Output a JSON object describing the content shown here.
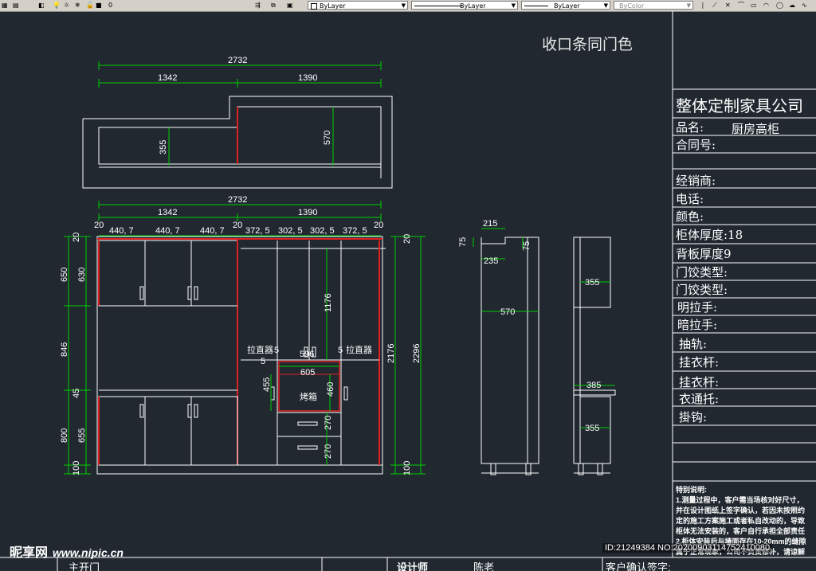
{
  "toolbar": {
    "layer_number": "0",
    "color_control": "ByLayer",
    "linetype_control": "ByLayer",
    "lineweight_control": "ByLayer",
    "plotstyle_control": "ByColor"
  },
  "drawing": {
    "note_title": "收口条同门色",
    "top_view": {
      "overall_width": "2732",
      "left_width": "1342",
      "right_width": "1390",
      "left_depth": "355",
      "right_depth": "570"
    },
    "front_view": {
      "overall_width": "2732",
      "left_width": "1342",
      "right_width": "1390",
      "columns_left": [
        "20",
        "440, 7",
        "440, 7",
        "440, 7",
        "20"
      ],
      "columns_right": [
        "372, 5",
        "302, 5",
        "302, 5",
        "372, 5",
        "20"
      ],
      "left_heights": [
        "650",
        "846",
        "800",
        "100"
      ],
      "left_inner_heights": [
        "20",
        "630",
        "45",
        "655"
      ],
      "right_heights": [
        "20",
        "2176",
        "2296",
        "100"
      ],
      "center_height": "1176",
      "pull_basket_label": "拉直器",
      "pull_basket_value": "5",
      "oven_width_top": "596",
      "oven_width": "605",
      "oven_gap": "5",
      "oven_height": "455",
      "oven_label": "烤箱",
      "oven_inner": "460",
      "drawer_height_1": "270",
      "drawer_height_2": "270"
    },
    "side_view_1": {
      "top_depth": "215",
      "top_height": "75",
      "top_height_2": "75",
      "inner": "235",
      "depth": "570"
    },
    "side_view_2": {
      "upper_depth": "355",
      "counter": "385",
      "lower_depth": "355"
    }
  },
  "title_block": {
    "company": "整体定制家具公司",
    "rows": [
      {
        "label": "品名:",
        "value": "厨房高柜"
      },
      {
        "label": "合同号:",
        "value": ""
      },
      {
        "label": "经销商:",
        "value": ""
      },
      {
        "label": "电话:",
        "value": ""
      },
      {
        "label": "颜色:",
        "value": ""
      },
      {
        "label": "柜体厚度:18",
        "value": ""
      },
      {
        "label": "背板厚度9",
        "value": ""
      },
      {
        "label": "门饺类型:",
        "value": ""
      },
      {
        "label": "门饺类型:",
        "value": ""
      },
      {
        "label": "明拉手:",
        "value": ""
      },
      {
        "label": "暗拉手:",
        "value": ""
      },
      {
        "label": "抽轨:",
        "value": ""
      },
      {
        "label": "挂衣杆:",
        "value": ""
      },
      {
        "label": "挂衣杆:",
        "value": ""
      },
      {
        "label": "衣通托:",
        "value": ""
      },
      {
        "label": "掛钩:",
        "value": ""
      }
    ],
    "notes_title": "特别说明:",
    "notes": [
      "1.测量过程中，客户需当场核对好尺寸，",
      "并在设计图纸上签字确认，若因未按照约",
      "定的施工方案施工或者私自改动的，导致",
      "柜体无法安装的，客户自行承担全部责任",
      "2.柜体安装后与墙面存在10-20mm的缝隙",
      "属于正常现象，公司不负责修补，请谅解"
    ]
  },
  "footer": {
    "left_label": "主开门",
    "designer_label": "设计师",
    "designer_name": "陈老",
    "client_confirm": "客户确认签字:"
  },
  "watermark": {
    "brand": "昵享网",
    "site": "www.nipic.cn"
  },
  "image_id": "ID:21249384 NO:20200903114752410080"
}
